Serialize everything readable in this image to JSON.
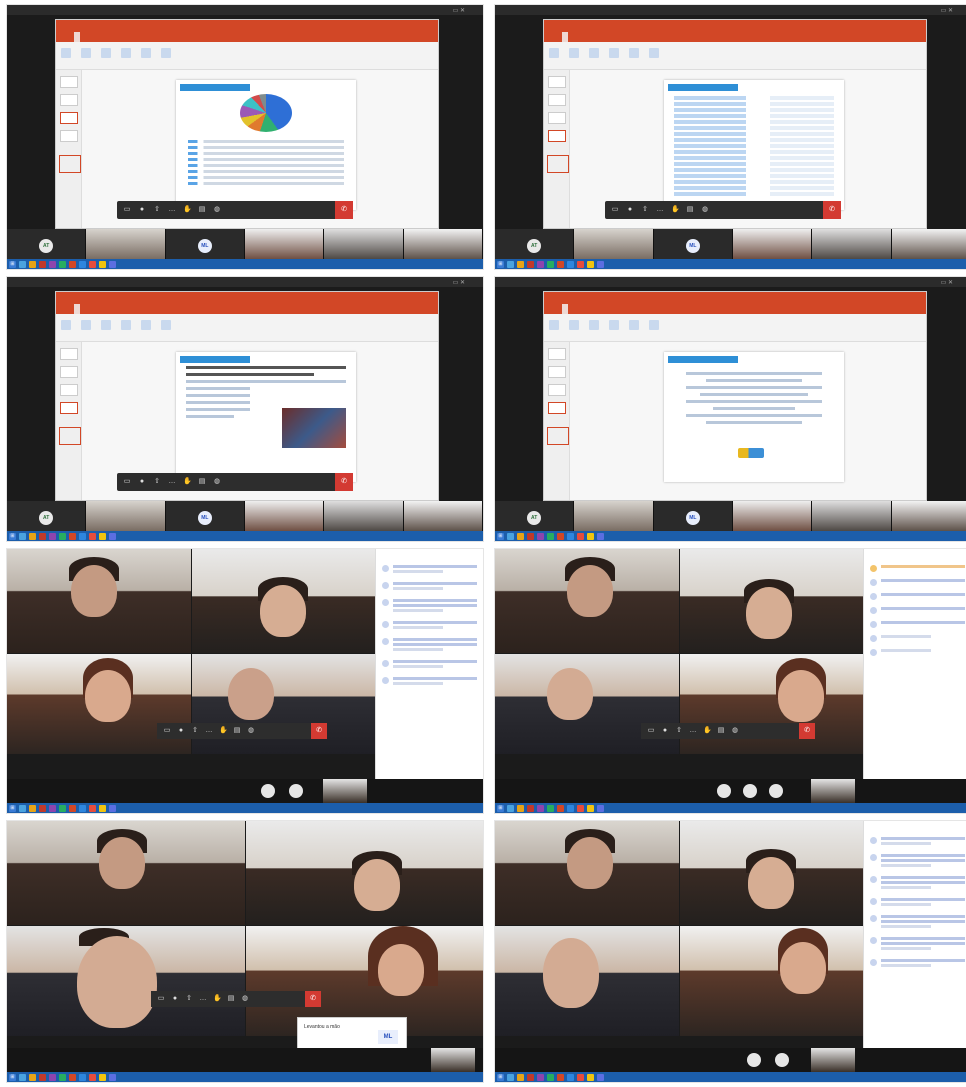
{
  "screenshots": [
    {
      "id": "p1",
      "kind": "share",
      "slide": "pie",
      "participant_avatars": [
        "AT",
        "ML"
      ]
    },
    {
      "id": "p2",
      "kind": "share",
      "slide": "table",
      "participant_avatars": [
        "AT",
        "ML"
      ]
    },
    {
      "id": "p3",
      "kind": "share",
      "slide": "text-image",
      "participant_avatars": [
        "AT",
        "ML"
      ]
    },
    {
      "id": "p4",
      "kind": "share",
      "slide": "text-logo",
      "participant_avatars": [
        "AT",
        "ML"
      ]
    },
    {
      "id": "p5",
      "kind": "video",
      "side_panel": "chat"
    },
    {
      "id": "p6",
      "kind": "video",
      "side_panel": "people"
    },
    {
      "id": "p7",
      "kind": "video",
      "toast": {
        "text": "Levantou a mão",
        "badge": "ML"
      }
    },
    {
      "id": "p8",
      "kind": "video",
      "side_panel": "chat"
    }
  ],
  "avatars": {
    "green": "AT",
    "blue": "ML"
  },
  "toast": {
    "text": "Levantou a mão",
    "badge": "ML"
  },
  "colors": {
    "powerpoint_header": "#d24726",
    "taskbar": "#1c5eab",
    "hangup": "#d33a32",
    "slide_accent": "#2e8fd6"
  },
  "icons": {
    "meet_bar": [
      "video-icon",
      "mic-icon",
      "share-icon",
      "more-icon",
      "hand-icon",
      "chat-icon",
      "people-icon"
    ],
    "hangup": "hangup-icon"
  }
}
